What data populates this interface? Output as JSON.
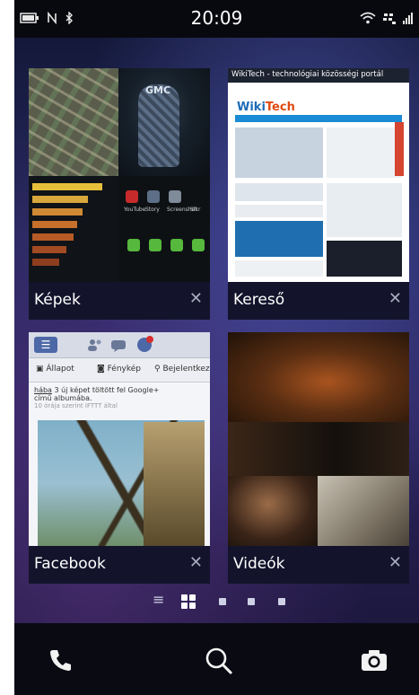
{
  "status_bar": {
    "time": "20:09",
    "left_icons": [
      "battery-icon",
      "nfc-icon",
      "bluetooth-icon"
    ],
    "right_icons": [
      "wifi-icon",
      "bbm-icon",
      "signal-icon"
    ]
  },
  "cards": [
    {
      "label": "Képek",
      "close": "✕"
    },
    {
      "label": "Kereső",
      "close": "✕"
    },
    {
      "label": "Facebook",
      "close": "✕"
    },
    {
      "label": "Videók",
      "close": "✕"
    }
  ],
  "browser_preview": {
    "title": "WikiTech - technológiai közösségi portál",
    "logo_a": "Wiki",
    "logo_b": "Tech"
  },
  "facebook_preview": {
    "menu_glyph": "☰",
    "tab_status": "Állapot",
    "tab_photo": "Fénykép",
    "tab_checkin": "Bejelentkez",
    "post_name": "hába",
    "post_text": "3 új képet töltött fel Google+",
    "post_text2": "című albumába.",
    "post_meta": "10 órája  szerint IFTTT által"
  },
  "video_preview": {},
  "gallery_preview": {
    "chair_text": "GMC",
    "app_labels": [
      "YouTube",
      "Story",
      "Screenshot",
      "Slkr"
    ]
  },
  "pager": {
    "list_glyph": "≡",
    "active_index": 0,
    "dots": 3
  },
  "dock": {
    "phone": "phone-icon",
    "search": "search-icon",
    "camera": "camera-icon"
  },
  "colors": {
    "card_label_bg": "#12142d",
    "accent_blue": "#1a8bd4",
    "facebook_blue": "#4d68a6"
  }
}
